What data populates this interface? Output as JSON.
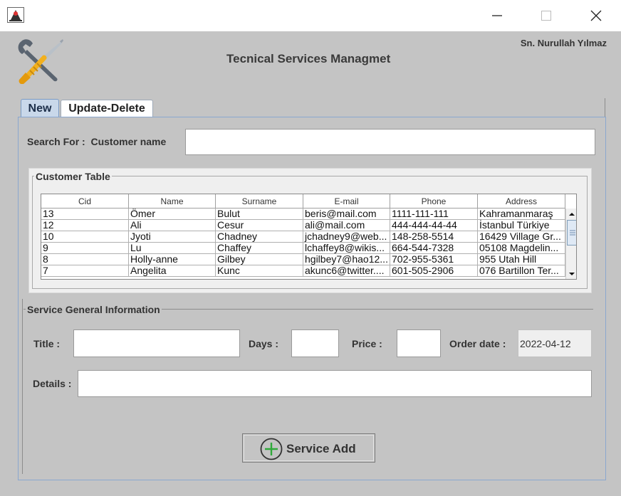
{
  "window": {
    "icon": "java-duke-icon",
    "controls": [
      "minimize-icon",
      "maximize-icon",
      "close-icon"
    ]
  },
  "header": {
    "title": "Tecnical Services Managmet",
    "user": "Sn. Nurullah Yılmaz",
    "logo": "wrench-screwdriver-icon"
  },
  "tabs": [
    {
      "label": "New",
      "selected": true
    },
    {
      "label": "Update-Delete",
      "selected": false
    }
  ],
  "search": {
    "label": "Search For :  Customer name",
    "value": ""
  },
  "customer_table": {
    "legend": "Customer Table",
    "columns": [
      "Cid",
      "Name",
      "Surname",
      "E-mail",
      "Phone",
      "Address"
    ],
    "rows": [
      [
        "13",
        "Ömer",
        "Bulut",
        "beris@mail.com",
        "1111-111-111",
        "Kahramanmaraş"
      ],
      [
        "12",
        "Ali",
        "Cesur",
        "ali@mail.com",
        "444-444-44-44",
        "İstanbul Türkiye"
      ],
      [
        "10",
        "Jyoti",
        "Chadney",
        "jchadney9@web...",
        "148-258-5514",
        "16429 Village Gr..."
      ],
      [
        "9",
        "Lu",
        "Chaffey",
        "lchaffey8@wikis...",
        "664-544-7328",
        "05108 Magdelin..."
      ],
      [
        "8",
        "Holly-anne",
        "Gilbey",
        "hgilbey7@hao12...",
        "702-955-5361",
        "955 Utah Hill"
      ],
      [
        "7",
        "Angelita",
        "Kunc",
        "akunc6@twitter....",
        "601-505-2906",
        "076 Bartillon Ter..."
      ]
    ]
  },
  "service": {
    "legend": "Service General Information",
    "title_label": "Title :",
    "title_value": "",
    "days_label": "Days :",
    "days_value": "",
    "price_label": "Price :",
    "price_value": "",
    "order_date_label": "Order date :",
    "order_date_value": "2022-04-12",
    "details_label": "Details :",
    "details_value": "",
    "add_button_label": "Service Add",
    "add_icon": "plus-circle-icon"
  }
}
